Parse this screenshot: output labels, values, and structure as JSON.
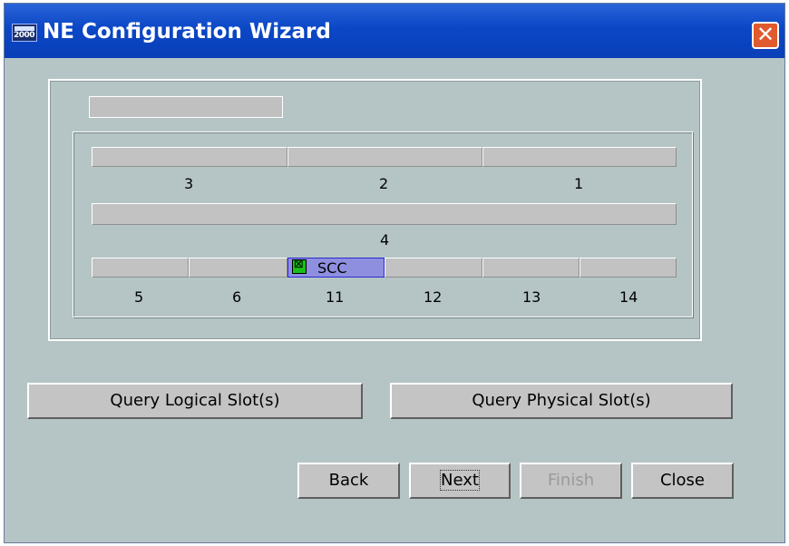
{
  "window": {
    "title": "NE Configuration Wizard",
    "icon_year": "2000",
    "close_glyph": "✕"
  },
  "rack": {
    "top_slot": "",
    "row1_numbers": [
      "3",
      "2",
      "1"
    ],
    "row2_number": "4",
    "row3_numbers": [
      "5",
      "6",
      "11",
      "12",
      "13",
      "14"
    ],
    "scc_label": "SCC"
  },
  "buttons": {
    "query_logical": "Query Logical Slot(s)",
    "query_physical": "Query Physical Slot(s)",
    "back": "Back",
    "next": "Next",
    "finish": "Finish",
    "close": "Close"
  },
  "colors": {
    "titlebar": "#0b47c6",
    "background": "#b5c5c5",
    "scc_slot": "#8f8fe0",
    "scc_icon": "#18c018"
  }
}
